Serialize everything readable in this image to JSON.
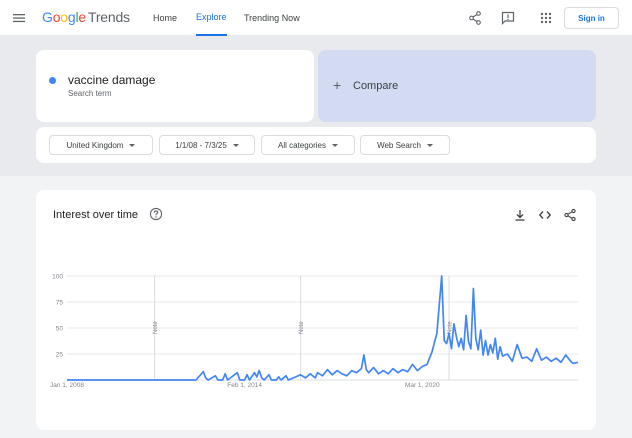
{
  "header": {
    "logo_google": [
      "G",
      "o",
      "o",
      "g",
      "l",
      "e"
    ],
    "logo_product": "Trends",
    "nav": [
      {
        "label": "Home"
      },
      {
        "label": "Explore"
      },
      {
        "label": "Trending Now"
      }
    ],
    "active_nav": "Explore",
    "sign_in_label": "Sign in"
  },
  "search": {
    "term": "vaccine damage",
    "term_caption": "Search term",
    "term_color": "#4285f4",
    "compare_label": "Compare"
  },
  "filters": {
    "region": "United Kingdom",
    "date_range": "1/1/08 - 7/3/25",
    "category": "All categories",
    "search_type": "Web Search"
  },
  "chart_card": {
    "title": "Interest over time"
  },
  "chart_data": {
    "type": "line",
    "title": "Interest over time",
    "ylim": [
      0,
      100
    ],
    "yticks": [
      "100",
      "75",
      "50",
      "25"
    ],
    "xticks": [
      "Jan 1, 2008",
      "Feb 1, 2014",
      "Mar 1, 2020"
    ],
    "xlim": [
      "2008-01",
      "2025-07"
    ],
    "notes": [
      {
        "label": "Note",
        "date": "2011-01"
      },
      {
        "label": "Note",
        "date": "2016-01"
      },
      {
        "label": "Note",
        "date": "2021-02"
      }
    ],
    "series": [
      {
        "color": "#4285f4",
        "points": [
          [
            "2008-01",
            0
          ],
          [
            "2009-06",
            0
          ],
          [
            "2011-01",
            0
          ],
          [
            "2012-01",
            0
          ],
          [
            "2012-06",
            0
          ],
          [
            "2012-09",
            8
          ],
          [
            "2012-10",
            2
          ],
          [
            "2012-11",
            0
          ],
          [
            "2013-02",
            4
          ],
          [
            "2013-03",
            0
          ],
          [
            "2013-05",
            0
          ],
          [
            "2013-06",
            6
          ],
          [
            "2013-07",
            0
          ],
          [
            "2013-11",
            7
          ],
          [
            "2013-12",
            0
          ],
          [
            "2014-02",
            0
          ],
          [
            "2014-03",
            5
          ],
          [
            "2014-04",
            0
          ],
          [
            "2014-06",
            7
          ],
          [
            "2014-07",
            3
          ],
          [
            "2014-08",
            9
          ],
          [
            "2014-09",
            2
          ],
          [
            "2014-10",
            0
          ],
          [
            "2014-12",
            5
          ],
          [
            "2015-01",
            0
          ],
          [
            "2015-03",
            0
          ],
          [
            "2015-04",
            3
          ],
          [
            "2015-05",
            0
          ],
          [
            "2015-07",
            4
          ],
          [
            "2015-08",
            0
          ],
          [
            "2015-11",
            3
          ],
          [
            "2016-01",
            5
          ],
          [
            "2016-03",
            2
          ],
          [
            "2016-05",
            6
          ],
          [
            "2016-07",
            2
          ],
          [
            "2016-08",
            7
          ],
          [
            "2016-10",
            4
          ],
          [
            "2016-12",
            10
          ],
          [
            "2017-02",
            5
          ],
          [
            "2017-04",
            9
          ],
          [
            "2017-06",
            6
          ],
          [
            "2017-08",
            4
          ],
          [
            "2017-10",
            9
          ],
          [
            "2017-12",
            7
          ],
          [
            "2018-02",
            11
          ],
          [
            "2018-03",
            24
          ],
          [
            "2018-04",
            10
          ],
          [
            "2018-05",
            7
          ],
          [
            "2018-07",
            12
          ],
          [
            "2018-09",
            6
          ],
          [
            "2018-11",
            9
          ],
          [
            "2019-01",
            6
          ],
          [
            "2019-03",
            11
          ],
          [
            "2019-05",
            7
          ],
          [
            "2019-07",
            10
          ],
          [
            "2019-09",
            8
          ],
          [
            "2019-11",
            15
          ],
          [
            "2020-01",
            9
          ],
          [
            "2020-03",
            13
          ],
          [
            "2020-05",
            15
          ],
          [
            "2020-07",
            27
          ],
          [
            "2020-09",
            45
          ],
          [
            "2020-11",
            100
          ],
          [
            "2020-12",
            38
          ],
          [
            "2021-01",
            35
          ],
          [
            "2021-02",
            45
          ],
          [
            "2021-03",
            30
          ],
          [
            "2021-04",
            54
          ],
          [
            "2021-05",
            42
          ],
          [
            "2021-06",
            32
          ],
          [
            "2021-07",
            40
          ],
          [
            "2021-08",
            29
          ],
          [
            "2021-09",
            62
          ],
          [
            "2021-10",
            37
          ],
          [
            "2021-11",
            30
          ],
          [
            "2021-12",
            88
          ],
          [
            "2022-01",
            40
          ],
          [
            "2022-02",
            29
          ],
          [
            "2022-03",
            48
          ],
          [
            "2022-04",
            24
          ],
          [
            "2022-05",
            38
          ],
          [
            "2022-06",
            24
          ],
          [
            "2022-07",
            34
          ],
          [
            "2022-08",
            26
          ],
          [
            "2022-09",
            40
          ],
          [
            "2022-10",
            20
          ],
          [
            "2022-11",
            32
          ],
          [
            "2022-12",
            23
          ],
          [
            "2023-02",
            25
          ],
          [
            "2023-04",
            18
          ],
          [
            "2023-06",
            34
          ],
          [
            "2023-08",
            21
          ],
          [
            "2023-10",
            22
          ],
          [
            "2023-12",
            18
          ],
          [
            "2024-02",
            30
          ],
          [
            "2024-04",
            19
          ],
          [
            "2024-06",
            22
          ],
          [
            "2024-08",
            18
          ],
          [
            "2024-10",
            21
          ],
          [
            "2024-12",
            17
          ],
          [
            "2025-02",
            24
          ],
          [
            "2025-04",
            18
          ],
          [
            "2025-05",
            16
          ],
          [
            "2025-07",
            17
          ]
        ]
      }
    ]
  }
}
